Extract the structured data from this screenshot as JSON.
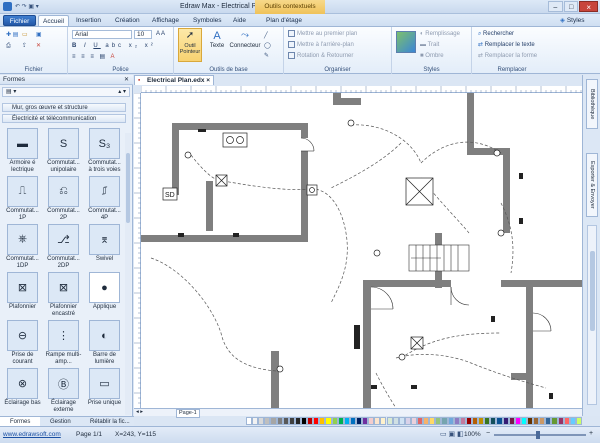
{
  "window": {
    "title": "Edraw Max - Electrical Plan.edx",
    "context_tab": "Outils contextuels",
    "controls": [
      "–",
      "□",
      "×"
    ]
  },
  "ribbon_tabs": {
    "file": "Fichier",
    "tabs": [
      "Accueil",
      "Insertion",
      "Création",
      "Affichage",
      "Symboles",
      "Aide",
      "Plan d'étage"
    ],
    "styles": "Styles"
  },
  "ribbon": {
    "file_group": "Fichier",
    "police": {
      "label": "Police",
      "font": "Arial",
      "size": "10"
    },
    "outils": {
      "label": "Outils de base",
      "pointer": "Outil\nPointeur",
      "text": "Texte",
      "connector": "Connecteur"
    },
    "organiser": {
      "label": "Organiser",
      "items": [
        "Mettre au premier plan",
        "Mettre à l'arrière-plan",
        "Rotation & Retourner"
      ]
    },
    "styles": {
      "label": "Styles",
      "items": [
        "Remplissage",
        "Trait",
        "Ombre"
      ]
    },
    "remplacer": {
      "label": "Remplacer",
      "items": [
        "Rechercher",
        "Remplacer le texte",
        "Remplacer la forme"
      ]
    }
  },
  "left_panel": {
    "title": "Formes",
    "categories": [
      "Mur, gros œuvre et structure",
      "Électricité et télécommunication"
    ],
    "shapes": [
      [
        "Armoire é lectrique",
        "Commutat... unipolaire",
        "Commutat... à trois voies"
      ],
      [
        "Commutat... 1P",
        "Commutat... 2P",
        "Commutat... 4P"
      ],
      [
        "Commutat... 1DP",
        "Commutat... 2DP",
        "Swivel"
      ],
      [
        "Plafonnier",
        "Plafonnier encastré",
        "Applique"
      ],
      [
        "Prise de courant",
        "Rampe multi-amp...",
        "Barre de lumière"
      ],
      [
        "Éclairage bas",
        "Éclairage externe",
        "Prise unique"
      ]
    ]
  },
  "document": {
    "tab": "Electrical Plan.edx",
    "page_tab": "Page-1",
    "sd_label": "SD"
  },
  "right_bar": {
    "tabs": [
      "Bibliothèque",
      "Exporter & Envoyer"
    ]
  },
  "bottom_tabs": [
    "Formes",
    "Gestion",
    "Rétablir la fic..."
  ],
  "status": {
    "url": "www.edrawsoft.com",
    "page": "Page 1/1",
    "coords": "X=243, Y=115",
    "zoom": "100%"
  },
  "palette_colors": [
    "#ffffff",
    "#f2f2f2",
    "#d9d9d9",
    "#bfbfbf",
    "#a6a6a6",
    "#808080",
    "#595959",
    "#404040",
    "#262626",
    "#000000",
    "#c00000",
    "#ff0000",
    "#ffc000",
    "#ffff00",
    "#92d050",
    "#00b050",
    "#00b0f0",
    "#0070c0",
    "#002060",
    "#7030a0",
    "#f4cccc",
    "#fce5cd",
    "#fff2cc",
    "#d9ead3",
    "#d0e0e3",
    "#cfe2f3",
    "#d9d2e9",
    "#ead1dc",
    "#e06666",
    "#f6b26b",
    "#ffd966",
    "#93c47d",
    "#76a5af",
    "#6fa8dc",
    "#8e7cc3",
    "#c27ba0",
    "#990000",
    "#b45f06",
    "#bf9000",
    "#38761d",
    "#134f5c",
    "#0b5394",
    "#351c75",
    "#741b47",
    "#ff00ff",
    "#00ffff",
    "#663300",
    "#996633",
    "#cc9966",
    "#336699",
    "#669933",
    "#993366",
    "#ff6666",
    "#66ccff",
    "#ccff66"
  ]
}
